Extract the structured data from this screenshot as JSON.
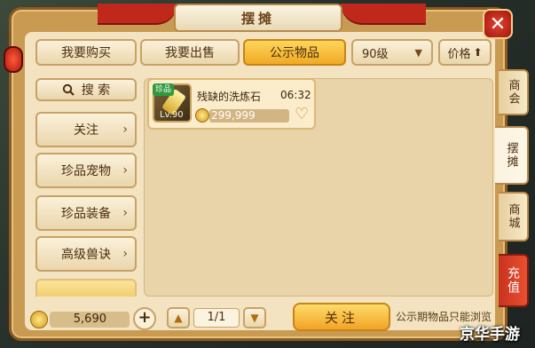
{
  "window": {
    "title": "摆摊",
    "close_label": "✕"
  },
  "tabs": {
    "buy": "我要购买",
    "sell": "我要出售",
    "public": "公示物品",
    "level": "90级",
    "level_arrow": "▼",
    "price_sort": "价格",
    "price_sort_arrow": "⬆"
  },
  "left_panel": {
    "search": "搜 索",
    "categories": [
      "关注",
      "珍品宠物",
      "珍品装备",
      "高级兽诀"
    ],
    "chevron": "›"
  },
  "listing": {
    "items": [
      {
        "badge": "珍品",
        "level": "Lv.90",
        "name": "残缺的洗炼石",
        "time": "06:32",
        "price": "299,999",
        "favorite_icon": "heart-icon"
      }
    ]
  },
  "side_tabs": [
    "商会",
    "摆摊",
    "商城",
    "充值"
  ],
  "bottom_bar": {
    "money": "5,690",
    "plus": "+",
    "prev": "▲",
    "next": "▼",
    "page": "1/1",
    "follow_button": "关注",
    "note": "公示期物品只能浏览"
  },
  "watermark": "京华手游",
  "colors": {
    "active_tab": "#f0a925",
    "recharge": "#c8321e",
    "close": "#e8432f"
  }
}
